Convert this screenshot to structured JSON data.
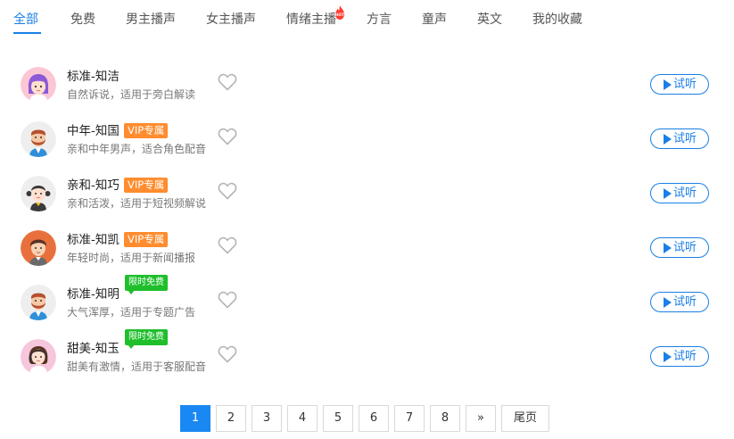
{
  "tabs": [
    {
      "label": "全部",
      "active": true
    },
    {
      "label": "免费"
    },
    {
      "label": "男主播声"
    },
    {
      "label": "女主播声"
    },
    {
      "label": "情绪主播",
      "hot": true
    },
    {
      "label": "方言"
    },
    {
      "label": "童声"
    },
    {
      "label": "英文"
    },
    {
      "label": "我的收藏"
    }
  ],
  "hot_badge_text": "HOT",
  "voices": [
    {
      "name": "标准-知洁",
      "desc": "自然诉说，适用于旁白解读",
      "badge": null,
      "avatar": "female-purple-hair-avatar"
    },
    {
      "name": "中年-知国",
      "desc": "亲和中年男声，适合角色配音",
      "badge": "VIP专属",
      "badge_type": "vip",
      "avatar": "bearded-man-avatar"
    },
    {
      "name": "亲和-知巧",
      "desc": "亲和活泼，适用于短视频解说",
      "badge": "VIP专属",
      "badge_type": "vip",
      "avatar": "pigtail-girl-avatar"
    },
    {
      "name": "标准-知凯",
      "desc": "年轻时尚，适用于新闻播报",
      "badge": "VIP专属",
      "badge_type": "vip",
      "avatar": "young-man-avatar"
    },
    {
      "name": "标准-知明",
      "desc": "大气浑厚，适用于专题广告",
      "badge": "限时免费",
      "badge_type": "free",
      "avatar": "bearded-man-avatar"
    },
    {
      "name": "甜美-知玉",
      "desc": "甜美有激情，适用于客服配音",
      "badge": "限时免费",
      "badge_type": "free",
      "avatar": "headset-woman-avatar"
    }
  ],
  "play_label": "试听",
  "pagination": {
    "pages": [
      "1",
      "2",
      "3",
      "4",
      "5",
      "6",
      "7",
      "8"
    ],
    "current": "1",
    "next_label": "»",
    "last_label": "尾页"
  },
  "colors": {
    "accent": "#1a7fe6",
    "vip": "#ff8c2e",
    "free": "#1fbf2c",
    "hot": "#ff3b2f"
  }
}
